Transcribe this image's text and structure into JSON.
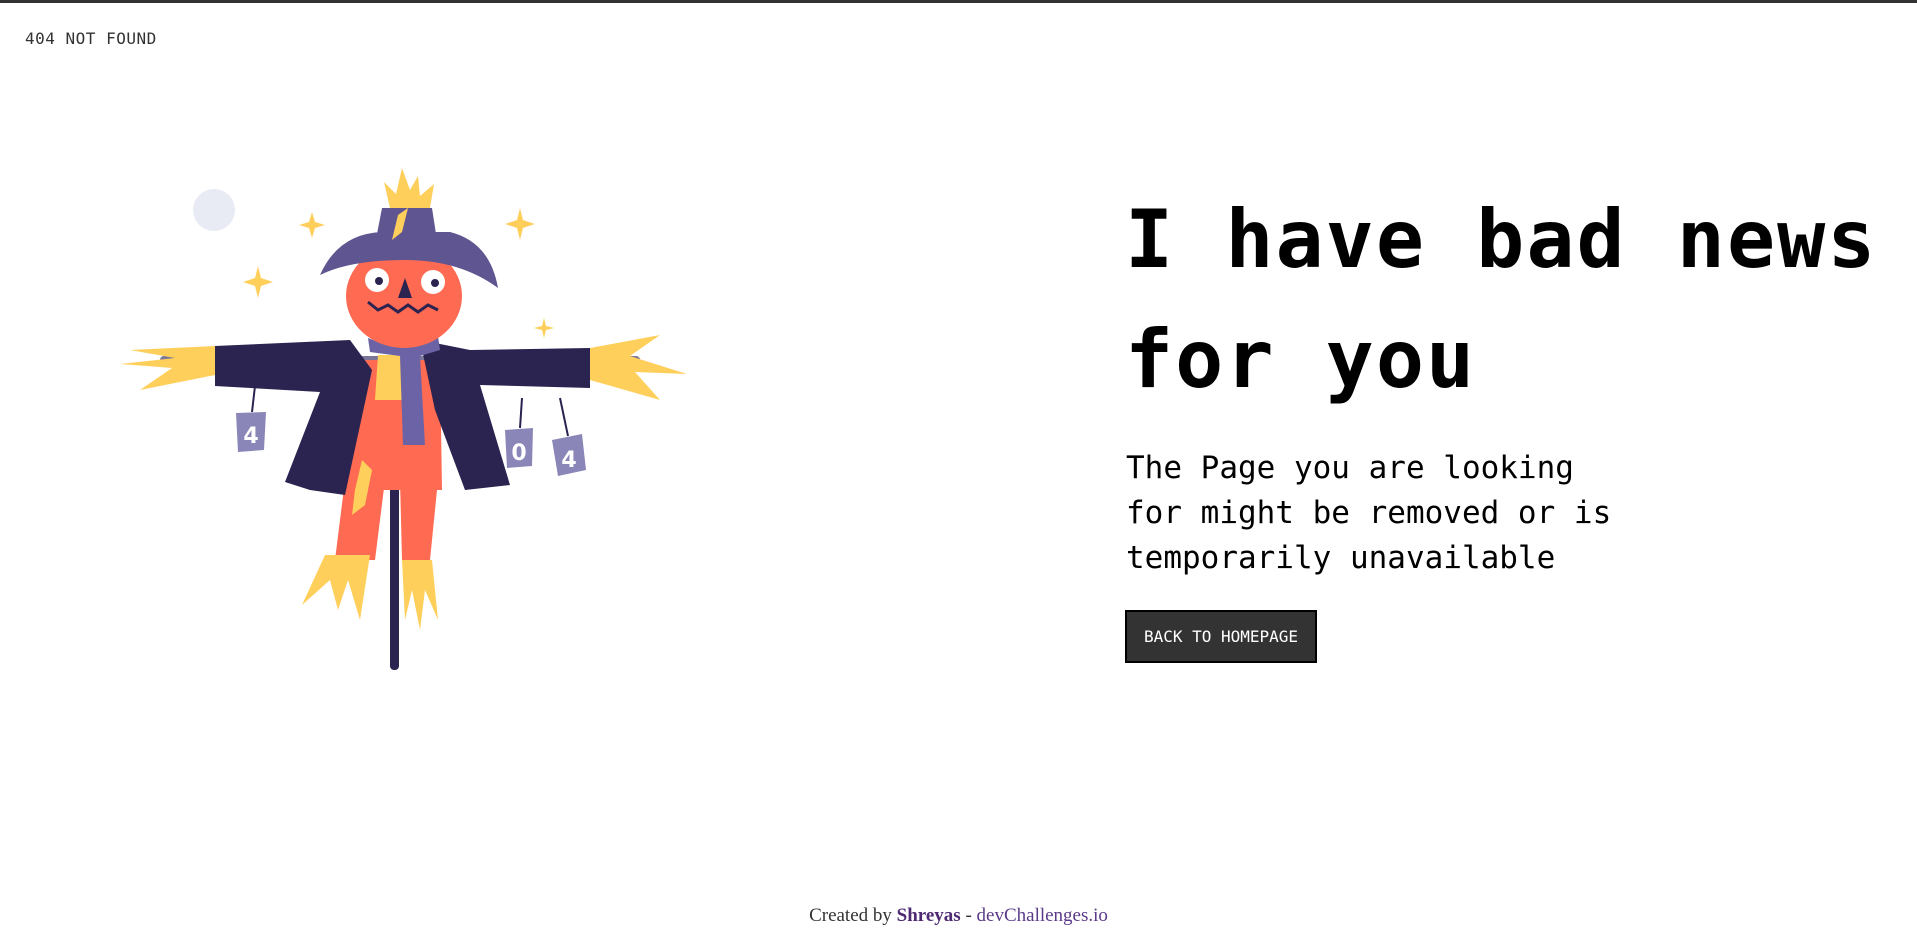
{
  "brand": {
    "label": "404 NOT FOUND"
  },
  "illustration": {
    "icon": "scarecrow-illustration",
    "cans": [
      "4",
      "0",
      "4"
    ],
    "colors": {
      "hat": "#5f5590",
      "coat": "#2b2350",
      "face": "#ff6b52",
      "straw": "#ffcf5c",
      "scarf": "#6c63a6",
      "can": "#8b86b8",
      "moon": "#e8eaf4"
    }
  },
  "main": {
    "headline_line1": "I have bad news",
    "headline_line2": "for you",
    "message_line1": "The Page you are looking",
    "message_line2": "for might be removed or is",
    "message_line3": "temporarily unavailable",
    "button_label": "BACK TO HOMEPAGE"
  },
  "footer": {
    "prefix": "Created by",
    "author": "Shreyas",
    "separator": "-",
    "site": "devChallenges.io"
  },
  "colors": {
    "text": "#000000",
    "button_bg": "#333333",
    "button_text": "#ffffff",
    "author": "#4f2a73"
  }
}
